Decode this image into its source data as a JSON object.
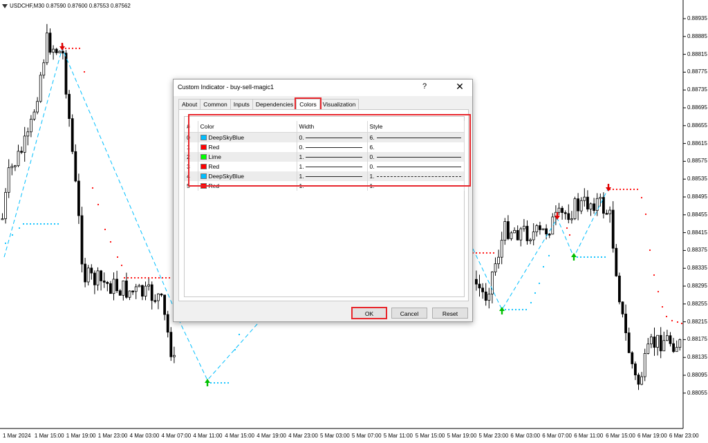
{
  "chart": {
    "symbol_info": "USDCHF,M30  0.87590 0.87600 0.87553 0.87562",
    "price_ticks": [
      "0.88935",
      "0.88885",
      "0.88815",
      "0.88775",
      "0.88735",
      "0.88695",
      "0.88655",
      "0.88615",
      "0.88575",
      "0.88535",
      "0.88495",
      "0.88455",
      "0.88415",
      "0.88375",
      "0.88335",
      "0.88295",
      "0.88255",
      "0.88215",
      "0.88175",
      "0.88135",
      "0.88095",
      "0.88055"
    ],
    "time_ticks": [
      "1 Mar 2024",
      "1 Mar 15:00",
      "1 Mar 19:00",
      "1 Mar 23:00",
      "4 Mar 03:00",
      "4 Mar 07:00",
      "4 Mar 11:00",
      "4 Mar 15:00",
      "4 Mar 19:00",
      "4 Mar 23:00",
      "5 Mar 03:00",
      "5 Mar 07:00",
      "5 Mar 11:00",
      "5 Mar 15:00",
      "5 Mar 19:00",
      "5 Mar 23:00",
      "6 Mar 03:00",
      "6 Mar 07:00",
      "6 Mar 11:00",
      "6 Mar 15:00",
      "6 Mar 19:00",
      "6 Mar 23:00"
    ],
    "colors": {
      "candle": "#000000",
      "dots_red": "#ff0000",
      "dots_blue": "#00bfff",
      "zigzag": "#00bfff",
      "arrow_up": "#00c000",
      "arrow_down": "#e00000"
    }
  },
  "dialog": {
    "title": "Custom Indicator - buy-sell-magic1",
    "help_label": "?",
    "close_label": "✕",
    "tabs": [
      {
        "label": "About",
        "active": false
      },
      {
        "label": "Common",
        "active": false
      },
      {
        "label": "Inputs",
        "active": false
      },
      {
        "label": "Dependencies",
        "active": false
      },
      {
        "label": "Colors",
        "active": true
      },
      {
        "label": "Visualization",
        "active": false
      }
    ],
    "table": {
      "headers": [
        "#",
        "Color",
        "Width",
        "Style"
      ],
      "rows": [
        {
          "index": "0",
          "color_name": "DeepSkyBlue",
          "color_hex": "#00bfff",
          "width": "0.",
          "style": "6.",
          "line": "solid"
        },
        {
          "index": "1",
          "color_name": "Red",
          "color_hex": "#ff0000",
          "width": "0.",
          "style": "6.",
          "line": "none"
        },
        {
          "index": "2",
          "color_name": "Lime",
          "color_hex": "#00ff00",
          "width": "1.",
          "style": "0.",
          "line": "solid"
        },
        {
          "index": "3",
          "color_name": "Red",
          "color_hex": "#ff0000",
          "width": "1.",
          "style": "0.",
          "line": "solid"
        },
        {
          "index": "4",
          "color_name": "DeepSkyBlue",
          "color_hex": "#00bfff",
          "width": "1.",
          "style": "1.",
          "line": "dashed"
        },
        {
          "index": "5",
          "color_name": "Red",
          "color_hex": "#ff0000",
          "width": "1.",
          "style": "1.",
          "line": "dashed"
        }
      ]
    },
    "buttons": {
      "ok": "OK",
      "cancel": "Cancel",
      "reset": "Reset"
    },
    "highlight_color": "#e8252b"
  }
}
